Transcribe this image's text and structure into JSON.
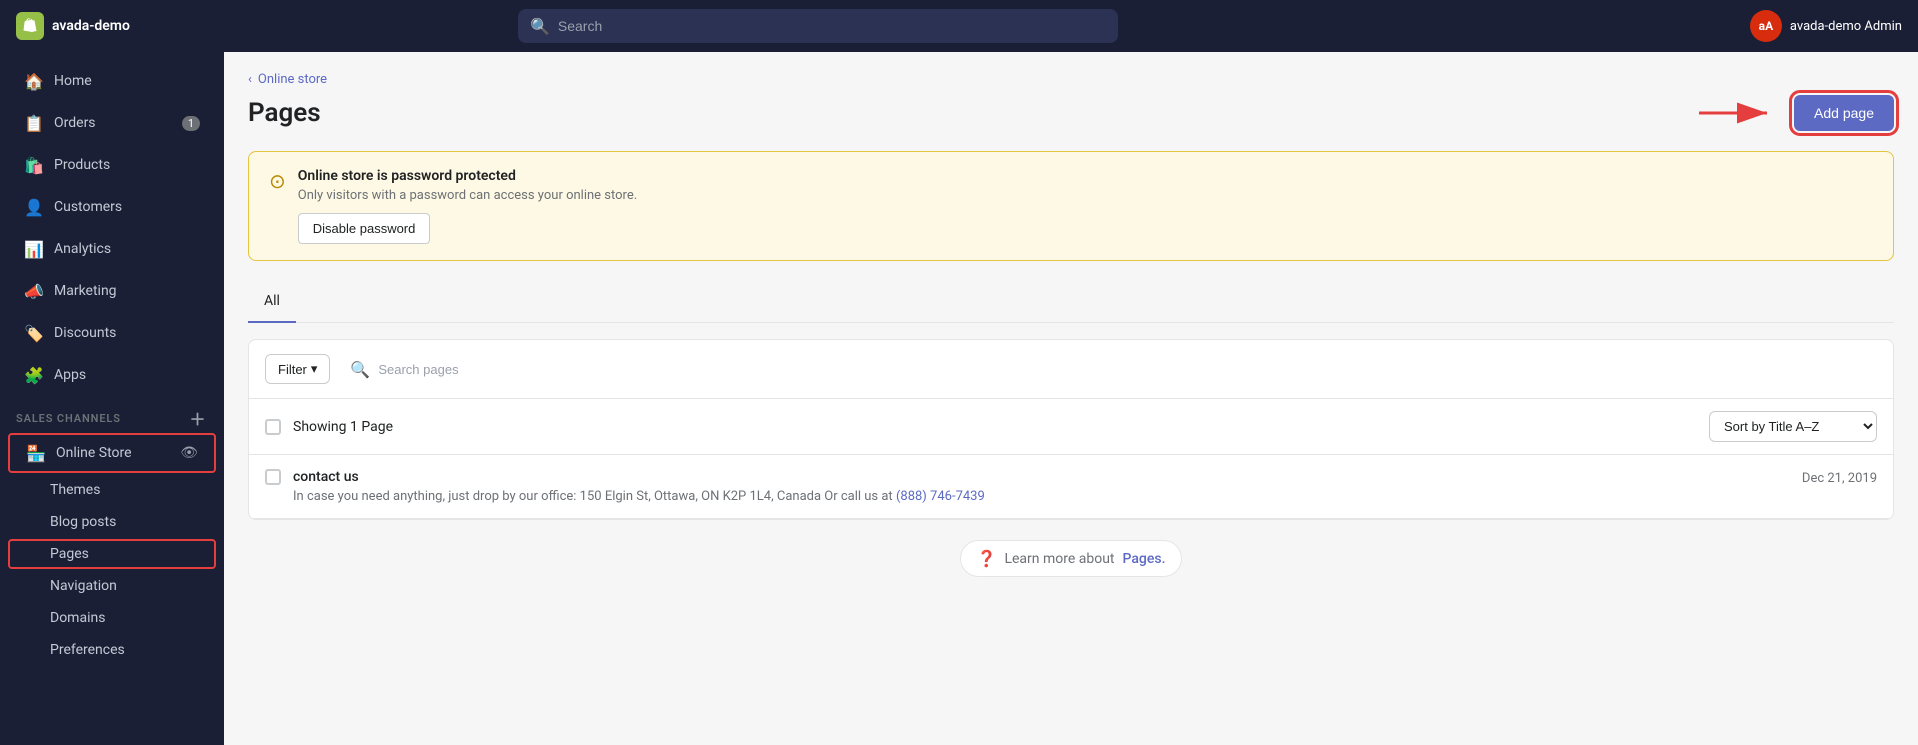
{
  "topnav": {
    "brand": "avada-demo",
    "logo_text": "S",
    "search_placeholder": "Search",
    "user_initials": "aA",
    "user_name": "avada-demo Admin"
  },
  "sidebar": {
    "nav_items": [
      {
        "id": "home",
        "label": "Home",
        "icon": "🏠",
        "badge": null
      },
      {
        "id": "orders",
        "label": "Orders",
        "icon": "📋",
        "badge": "1"
      },
      {
        "id": "products",
        "label": "Products",
        "icon": "🛍️",
        "badge": null
      },
      {
        "id": "customers",
        "label": "Customers",
        "icon": "👤",
        "badge": null
      },
      {
        "id": "analytics",
        "label": "Analytics",
        "icon": "📊",
        "badge": null
      },
      {
        "id": "marketing",
        "label": "Marketing",
        "icon": "📣",
        "badge": null
      },
      {
        "id": "discounts",
        "label": "Discounts",
        "icon": "🏷️",
        "badge": null
      },
      {
        "id": "apps",
        "label": "Apps",
        "icon": "🧩",
        "badge": null
      }
    ],
    "sales_channels_label": "SALES CHANNELS",
    "online_store_label": "Online Store",
    "sub_items": [
      {
        "id": "themes",
        "label": "Themes"
      },
      {
        "id": "blog-posts",
        "label": "Blog posts"
      },
      {
        "id": "pages",
        "label": "Pages"
      },
      {
        "id": "navigation",
        "label": "Navigation"
      },
      {
        "id": "domains",
        "label": "Domains"
      },
      {
        "id": "preferences",
        "label": "Preferences"
      }
    ]
  },
  "breadcrumb": {
    "text": "Online store",
    "chevron": "‹"
  },
  "page": {
    "title": "Pages",
    "add_button_label": "Add page"
  },
  "warning": {
    "title": "Online store is password protected",
    "description": "Only visitors with a password can access your online store.",
    "button_label": "Disable password"
  },
  "tabs": [
    {
      "id": "all",
      "label": "All",
      "active": true
    }
  ],
  "table": {
    "filter_label": "Filter",
    "search_placeholder": "Search pages",
    "showing_text": "Showing 1 Page",
    "sort_label": "Sort by Title A–Z",
    "rows": [
      {
        "title": "contact us",
        "description": "In case you need anything, just drop by our office: 150 Elgin St, Ottawa, ON K2P 1L4, Canada Or call us at",
        "link_text": "(888) 746-7439",
        "date": "Dec 21, 2019"
      }
    ]
  },
  "footer": {
    "learn_more_text": "Learn more about",
    "link_text": "Pages.",
    "link_url": "#"
  }
}
